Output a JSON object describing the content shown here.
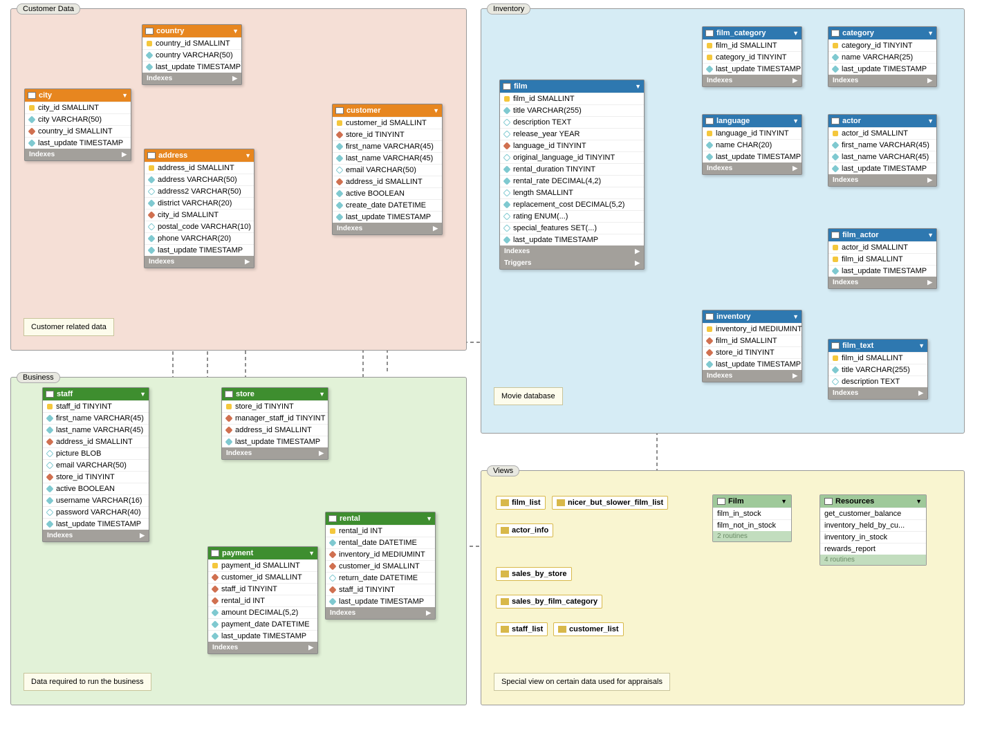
{
  "regions": {
    "customer": {
      "label": "Customer Data",
      "note": "Customer related data"
    },
    "business": {
      "label": "Business",
      "note": "Data required to run the business"
    },
    "inventory": {
      "label": "Inventory",
      "note": "Movie database"
    },
    "views": {
      "label": "Views",
      "note": "Special view on certain data used for appraisals"
    }
  },
  "footer_labels": {
    "indexes": "Indexes",
    "triggers": "Triggers"
  },
  "tables": {
    "country": {
      "name": "country",
      "cols": [
        {
          "icon": "pk",
          "text": "country_id SMALLINT"
        },
        {
          "icon": "col",
          "text": "country VARCHAR(50)"
        },
        {
          "icon": "col",
          "text": "last_update TIMESTAMP"
        }
      ]
    },
    "city": {
      "name": "city",
      "cols": [
        {
          "icon": "pk",
          "text": "city_id SMALLINT"
        },
        {
          "icon": "col",
          "text": "city VARCHAR(50)"
        },
        {
          "icon": "fk",
          "text": "country_id SMALLINT"
        },
        {
          "icon": "col",
          "text": "last_update TIMESTAMP"
        }
      ]
    },
    "address": {
      "name": "address",
      "cols": [
        {
          "icon": "pk",
          "text": "address_id SMALLINT"
        },
        {
          "icon": "col",
          "text": "address VARCHAR(50)"
        },
        {
          "icon": "colh",
          "text": "address2 VARCHAR(50)"
        },
        {
          "icon": "col",
          "text": "district VARCHAR(20)"
        },
        {
          "icon": "fk",
          "text": "city_id SMALLINT"
        },
        {
          "icon": "colh",
          "text": "postal_code VARCHAR(10)"
        },
        {
          "icon": "col",
          "text": "phone VARCHAR(20)"
        },
        {
          "icon": "col",
          "text": "last_update TIMESTAMP"
        }
      ]
    },
    "customer": {
      "name": "customer",
      "cols": [
        {
          "icon": "pk",
          "text": "customer_id SMALLINT"
        },
        {
          "icon": "fk",
          "text": "store_id TINYINT"
        },
        {
          "icon": "col",
          "text": "first_name VARCHAR(45)"
        },
        {
          "icon": "col",
          "text": "last_name VARCHAR(45)"
        },
        {
          "icon": "colh",
          "text": "email VARCHAR(50)"
        },
        {
          "icon": "fk",
          "text": "address_id SMALLINT"
        },
        {
          "icon": "col",
          "text": "active BOOLEAN"
        },
        {
          "icon": "col",
          "text": "create_date DATETIME"
        },
        {
          "icon": "col",
          "text": "last_update TIMESTAMP"
        }
      ]
    },
    "staff": {
      "name": "staff",
      "cols": [
        {
          "icon": "pk",
          "text": "staff_id TINYINT"
        },
        {
          "icon": "col",
          "text": "first_name VARCHAR(45)"
        },
        {
          "icon": "col",
          "text": "last_name VARCHAR(45)"
        },
        {
          "icon": "fk",
          "text": "address_id SMALLINT"
        },
        {
          "icon": "colh",
          "text": "picture BLOB"
        },
        {
          "icon": "colh",
          "text": "email VARCHAR(50)"
        },
        {
          "icon": "fk",
          "text": "store_id TINYINT"
        },
        {
          "icon": "col",
          "text": "active BOOLEAN"
        },
        {
          "icon": "col",
          "text": "username VARCHAR(16)"
        },
        {
          "icon": "colh",
          "text": "password VARCHAR(40)"
        },
        {
          "icon": "col",
          "text": "last_update TIMESTAMP"
        }
      ]
    },
    "store": {
      "name": "store",
      "cols": [
        {
          "icon": "pk",
          "text": "store_id TINYINT"
        },
        {
          "icon": "fk",
          "text": "manager_staff_id TINYINT"
        },
        {
          "icon": "fk",
          "text": "address_id SMALLINT"
        },
        {
          "icon": "col",
          "text": "last_update TIMESTAMP"
        }
      ]
    },
    "payment": {
      "name": "payment",
      "cols": [
        {
          "icon": "pk",
          "text": "payment_id SMALLINT"
        },
        {
          "icon": "fk",
          "text": "customer_id SMALLINT"
        },
        {
          "icon": "fk",
          "text": "staff_id TINYINT"
        },
        {
          "icon": "fk",
          "text": "rental_id INT"
        },
        {
          "icon": "col",
          "text": "amount DECIMAL(5,2)"
        },
        {
          "icon": "col",
          "text": "payment_date DATETIME"
        },
        {
          "icon": "col",
          "text": "last_update TIMESTAMP"
        }
      ]
    },
    "rental": {
      "name": "rental",
      "cols": [
        {
          "icon": "pk",
          "text": "rental_id INT"
        },
        {
          "icon": "col",
          "text": "rental_date DATETIME"
        },
        {
          "icon": "fk",
          "text": "inventory_id MEDIUMINT"
        },
        {
          "icon": "fk",
          "text": "customer_id SMALLINT"
        },
        {
          "icon": "colh",
          "text": "return_date DATETIME"
        },
        {
          "icon": "fk",
          "text": "staff_id TINYINT"
        },
        {
          "icon": "col",
          "text": "last_update TIMESTAMP"
        }
      ]
    },
    "film": {
      "name": "film",
      "cols": [
        {
          "icon": "pk",
          "text": "film_id SMALLINT"
        },
        {
          "icon": "col",
          "text": "title VARCHAR(255)"
        },
        {
          "icon": "colh",
          "text": "description TEXT"
        },
        {
          "icon": "colh",
          "text": "release_year YEAR"
        },
        {
          "icon": "fk",
          "text": "language_id TINYINT"
        },
        {
          "icon": "colh",
          "text": "original_language_id TINYINT"
        },
        {
          "icon": "col",
          "text": "rental_duration TINYINT"
        },
        {
          "icon": "col",
          "text": "rental_rate DECIMAL(4,2)"
        },
        {
          "icon": "colh",
          "text": "length SMALLINT"
        },
        {
          "icon": "col",
          "text": "replacement_cost DECIMAL(5,2)"
        },
        {
          "icon": "colh",
          "text": "rating ENUM(...)"
        },
        {
          "icon": "colh",
          "text": "special_features SET(...)"
        },
        {
          "icon": "col",
          "text": "last_update TIMESTAMP"
        }
      ]
    },
    "film_category": {
      "name": "film_category",
      "cols": [
        {
          "icon": "pk",
          "text": "film_id SMALLINT"
        },
        {
          "icon": "pk",
          "text": "category_id TINYINT"
        },
        {
          "icon": "col",
          "text": "last_update TIMESTAMP"
        }
      ]
    },
    "category": {
      "name": "category",
      "cols": [
        {
          "icon": "pk",
          "text": "category_id TINYINT"
        },
        {
          "icon": "col",
          "text": "name VARCHAR(25)"
        },
        {
          "icon": "col",
          "text": "last_update TIMESTAMP"
        }
      ]
    },
    "language": {
      "name": "language",
      "cols": [
        {
          "icon": "pk",
          "text": "language_id TINYINT"
        },
        {
          "icon": "col",
          "text": "name CHAR(20)"
        },
        {
          "icon": "col",
          "text": "last_update TIMESTAMP"
        }
      ]
    },
    "actor": {
      "name": "actor",
      "cols": [
        {
          "icon": "pk",
          "text": "actor_id SMALLINT"
        },
        {
          "icon": "col",
          "text": "first_name VARCHAR(45)"
        },
        {
          "icon": "col",
          "text": "last_name VARCHAR(45)"
        },
        {
          "icon": "col",
          "text": "last_update TIMESTAMP"
        }
      ]
    },
    "film_actor": {
      "name": "film_actor",
      "cols": [
        {
          "icon": "pk",
          "text": "actor_id SMALLINT"
        },
        {
          "icon": "pk",
          "text": "film_id SMALLINT"
        },
        {
          "icon": "col",
          "text": "last_update TIMESTAMP"
        }
      ]
    },
    "inventory": {
      "name": "inventory",
      "cols": [
        {
          "icon": "pk",
          "text": "inventory_id MEDIUMINT"
        },
        {
          "icon": "fk",
          "text": "film_id SMALLINT"
        },
        {
          "icon": "fk",
          "text": "store_id TINYINT"
        },
        {
          "icon": "col",
          "text": "last_update TIMESTAMP"
        }
      ]
    },
    "film_text": {
      "name": "film_text",
      "cols": [
        {
          "icon": "pk",
          "text": "film_id SMALLINT"
        },
        {
          "icon": "col",
          "text": "title VARCHAR(255)"
        },
        {
          "icon": "colh",
          "text": "description TEXT"
        }
      ]
    }
  },
  "views": [
    {
      "name": "film_list"
    },
    {
      "name": "nicer_but_slower_film_list"
    },
    {
      "name": "actor_info"
    },
    {
      "name": "sales_by_store"
    },
    {
      "name": "sales_by_film_category"
    },
    {
      "name": "staff_list"
    },
    {
      "name": "customer_list"
    }
  ],
  "routines": {
    "film": {
      "title": "Film",
      "items": [
        "film_in_stock",
        "film_not_in_stock"
      ],
      "footer": "2 routines"
    },
    "resources": {
      "title": "Resources",
      "items": [
        "get_customer_balance",
        "inventory_held_by_cu...",
        "inventory_in_stock",
        "rewards_report"
      ],
      "footer": "4 routines"
    }
  }
}
